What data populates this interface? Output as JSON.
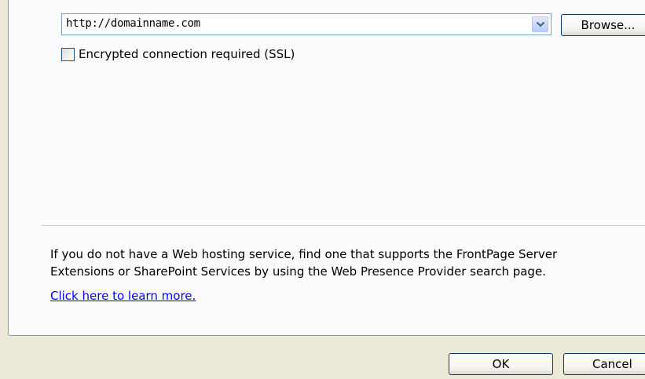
{
  "url_combo": {
    "value": "http://domainname.com",
    "dropdown_icon": "chevron-down-icon"
  },
  "browse_button": {
    "label": "Browse..."
  },
  "ssl": {
    "label": "Encrypted connection required (SSL)",
    "checked": false
  },
  "info": {
    "line1": "If you do not have a Web hosting service, find one that supports the FrontPage Server",
    "line2": "Extensions or SharePoint Services by using the Web Presence Provider search page.",
    "link": "Click here to learn more."
  },
  "footer": {
    "ok_label": "OK",
    "cancel_label": "Cancel"
  },
  "colors": {
    "dialog_bg": "#ece9d8",
    "panel_bg": "#fcfcfe",
    "link": "#0000ff",
    "button_border": "#003c74"
  }
}
